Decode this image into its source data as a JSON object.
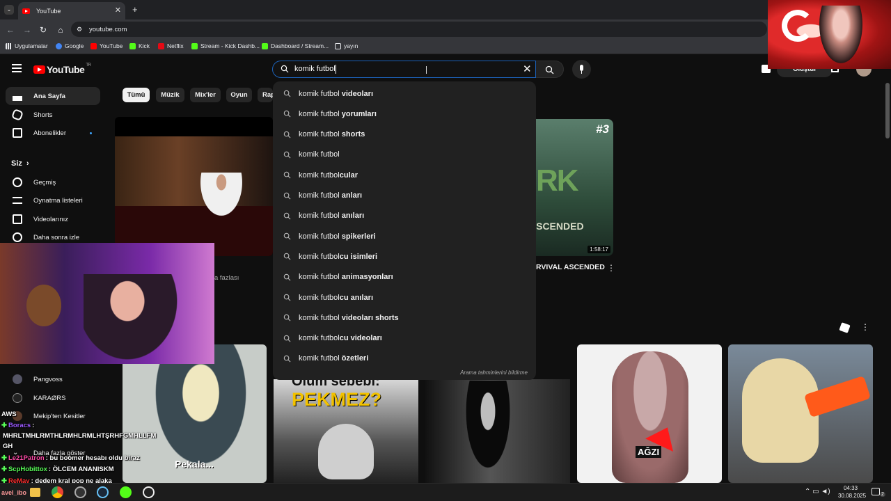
{
  "browser": {
    "tab_title": "YouTube",
    "url": "youtube.com",
    "bookmarks": [
      "Uygulamalar",
      "Google",
      "YouTube",
      "Kick",
      "Netflix",
      "Stream - Kick Dashb...",
      "Dashboard / Stream...",
      "yayın"
    ]
  },
  "header": {
    "logo_text": "YouTube",
    "logo_region": "TR",
    "search_value": "komik futbol",
    "create_label": "Oluştur"
  },
  "search_suggestions": {
    "typed": "komik futbol",
    "items": [
      {
        "typed": "komik futbol",
        "rest": " videoları"
      },
      {
        "typed": "komik futbol",
        "rest": " yorumları"
      },
      {
        "typed": "komik futbol",
        "rest": " shorts"
      },
      {
        "typed": "komik futbol",
        "rest": ""
      },
      {
        "typed": "komik futbol",
        "rest": "cular"
      },
      {
        "typed": "komik futbol",
        "rest": " anları"
      },
      {
        "typed": "komik futbol",
        "rest": " anıları"
      },
      {
        "typed": "komik futbol",
        "rest": " spikerleri"
      },
      {
        "typed": "komik futbol",
        "rest": "cu isimleri"
      },
      {
        "typed": "komik futbol",
        "rest": " animasyonları"
      },
      {
        "typed": "komik futbol",
        "rest": "cu anıları"
      },
      {
        "typed": "komik futbol",
        "rest": " videoları shorts"
      },
      {
        "typed": "komik futbol",
        "rest": "cu videoları"
      },
      {
        "typed": "komik futbol",
        "rest": " özetleri"
      }
    ],
    "report_text": "Arama tahminlerini bildirme"
  },
  "sidebar": {
    "top": [
      "Ana Sayfa",
      "Shorts",
      "Abonelikler"
    ],
    "you_heading": "Siz",
    "you_items": [
      "Geçmiş",
      "Oynatma listeleri",
      "Videolarınız",
      "Daha sonra izle"
    ],
    "subs": [
      "Pangvoss",
      "KARAØRS",
      "Mekip'ten Kesitler"
    ],
    "show_more": "Daha fazla göster"
  },
  "chips": [
    "Tümü",
    "Müzik",
    "Mix'ler",
    "Oyun",
    "Rap"
  ],
  "videos": {
    "v3_badge": "#3",
    "v3_thumb_text": "ASCENDED",
    "v3_duration": "1:58:17",
    "v3_title": "RVIVAL ASCENDED",
    "more_text": "a fazlası",
    "short1_caption": "Pekala...",
    "short2_top": "Ölüm sebebi:",
    "short2_main": "PEKMEZ?",
    "short4_caption": "AĞZI"
  },
  "chat": [
    {
      "user": "Boracs",
      "msg": ":",
      "color": "#9b59ff"
    },
    {
      "user": "",
      "msg": "MHRLTMHLRMTHLRMHLRMLHTŞRHFGMHLLFM",
      "color": "#fff"
    },
    {
      "user": "",
      "msg": "GH",
      "color": "#fff"
    },
    {
      "user": "Le21Patron",
      "msg": ": bu boomer hesabı oldu biraz",
      "color": "#ff4aa8"
    },
    {
      "user": "ScpHobittox",
      "msg": ": ÖLCEM ANANISKM",
      "color": "#59ff59"
    },
    {
      "user": "ReMay",
      "msg": ": dedem kral pop ne alaka",
      "color": "#ff3030"
    }
  ],
  "overlay_labels": {
    "aws": "AWS",
    "streamer_tag": "avel_ibo"
  },
  "taskbar": {
    "time": "04:33",
    "date": "30.08.2025",
    "notif_count": "2"
  },
  "colors": {
    "youtube_red": "#ff0000",
    "bg": "#0f0f0f",
    "focus_blue": "#1c62b9"
  }
}
